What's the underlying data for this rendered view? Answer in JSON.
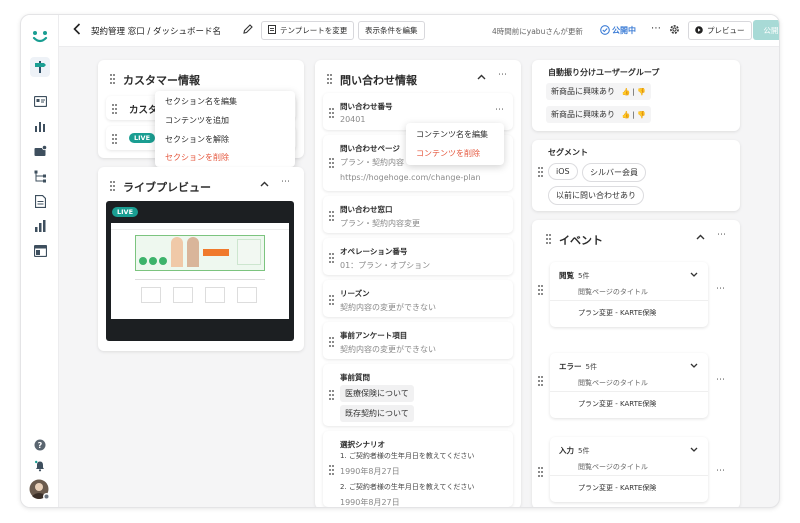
{
  "header": {
    "back_icon": "arrow-left-icon",
    "breadcrumb": "契約管理 窓口 / ダッシュボード名",
    "change_template_label": "テンプレートを変更",
    "edit_conditions_label": "表示条件を編集",
    "updated_text": "4時間前にyabuさんが更新",
    "status_label": "公開中",
    "preview_label": "プレビュー",
    "publish_label": "公開"
  },
  "colors": {
    "accent_teal": "#1a9e92",
    "status_blue": "#3a7bd5",
    "danger_red": "#e5573d",
    "publish_disabled": "#a8dad6"
  },
  "customer_section": {
    "title": "カスタマー情報",
    "row1_title": "カスタ",
    "live_label": "LIVE"
  },
  "context_menu_1": {
    "items": [
      "セクション名を編集",
      "コンテンツを追加",
      "セクションを解除",
      "セクションを削除"
    ]
  },
  "live_preview": {
    "title": "ライブプレビュー",
    "live_label": "LIVE"
  },
  "inquiry": {
    "title": "問い合わせ情報",
    "fields": [
      {
        "label": "問い合わせ番号",
        "value": "20401"
      },
      {
        "label": "問い合わせページ",
        "value": "プラン・契約内容",
        "value2": "https://hogehoge.com/change-plan"
      },
      {
        "label": "問い合わせ窓口",
        "value": "プラン・契約内容変更"
      },
      {
        "label": "オペレーション番号",
        "value": "01：プラン・オプション"
      },
      {
        "label": "リーズン",
        "value": "契約内容の変更ができない"
      },
      {
        "label": "事前アンケート項目",
        "value": "契約内容の変更ができない"
      },
      {
        "label": "事前質問",
        "chips": [
          "医療保険について",
          "既存契約について"
        ]
      },
      {
        "label": "選択シナリオ",
        "q1": "1. ご契約者様の生年月日を教えてください",
        "a1": "1990年8月27日",
        "q2": "2. ご契約者様の生年月日を教えてください",
        "a2": "1990年8月27日"
      }
    ]
  },
  "context_menu_2": {
    "items": [
      "コンテンツ名を編集",
      "コンテンツを削除"
    ]
  },
  "user_group": {
    "title": "自動振り分けユーザーグループ",
    "chips": [
      "新商品に興味あり",
      "新商品に興味あり"
    ],
    "chip_icons": "👍 | 👎"
  },
  "segment": {
    "title": "セグメント",
    "pills": [
      "iOS",
      "シルバー会員",
      "以前に問い合わせあり"
    ]
  },
  "events": {
    "title": "イベント",
    "items": [
      {
        "name": "閲覧",
        "count": "5件",
        "sub": "閲覧ページのタイトル",
        "plan": "プラン変更 - KARTE保険"
      },
      {
        "name": "エラー",
        "count": "5件",
        "sub": "閲覧ページのタイトル",
        "plan": "プラン変更 - KARTE保険"
      },
      {
        "name": "入力",
        "count": "5件",
        "sub": "閲覧ページのタイトル",
        "plan": "プラン変更 - KARTE保険"
      }
    ]
  },
  "rail_icons": [
    "karte-logo-icon",
    "signpost-icon",
    "id-card-icon",
    "bar-chart-icon",
    "inbox-icon",
    "flow-icon",
    "document-icon",
    "chart-icon",
    "layout-icon",
    "help-icon",
    "bell-icon",
    "avatar"
  ]
}
